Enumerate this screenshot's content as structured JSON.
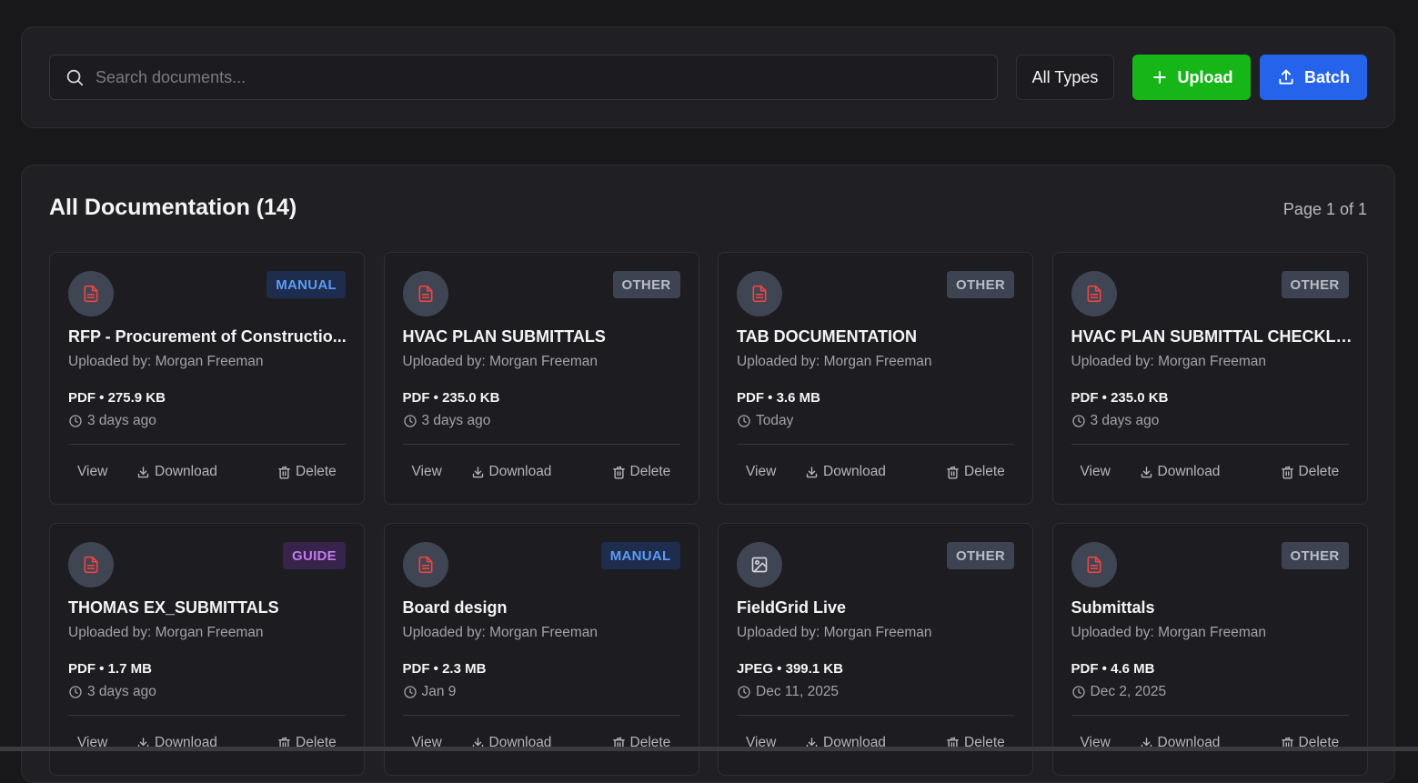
{
  "search": {
    "placeholder": "Search documents..."
  },
  "filters": {
    "type_selected": "All Types"
  },
  "actions": {
    "upload_label": "Upload",
    "batch_label": "Batch"
  },
  "documents": {
    "title": "All Documentation (14)",
    "page_info": "Page 1 of 1",
    "cards": [
      {
        "badge": "MANUAL",
        "badge_kind": "manual",
        "icon": "file-text-icon",
        "title": "RFP - Procurement of Constructio...",
        "uploader": "Uploaded by: Morgan Freeman",
        "meta": "PDF • 275.9 KB",
        "date": "3 days ago",
        "view": "View",
        "download": "Download",
        "delete": "Delete"
      },
      {
        "badge": "OTHER",
        "badge_kind": "other",
        "icon": "file-text-icon",
        "title": "HVAC PLAN SUBMITTALS",
        "uploader": "Uploaded by: Morgan Freeman",
        "meta": "PDF • 235.0 KB",
        "date": "3 days ago",
        "view": "View",
        "download": "Download",
        "delete": "Delete"
      },
      {
        "badge": "OTHER",
        "badge_kind": "other",
        "icon": "file-text-icon",
        "title": "TAB DOCUMENTATION",
        "uploader": "Uploaded by: Morgan Freeman",
        "meta": "PDF • 3.6 MB",
        "date": "Today",
        "view": "View",
        "download": "Download",
        "delete": "Delete"
      },
      {
        "badge": "OTHER",
        "badge_kind": "other",
        "icon": "file-text-icon",
        "title": "HVAC PLAN SUBMITTAL CHECKLI...",
        "uploader": "Uploaded by: Morgan Freeman",
        "meta": "PDF • 235.0 KB",
        "date": "3 days ago",
        "view": "View",
        "download": "Download",
        "delete": "Delete"
      },
      {
        "badge": "GUIDE",
        "badge_kind": "guide",
        "icon": "file-text-icon",
        "title": "THOMAS EX_SUBMITTALS",
        "uploader": "Uploaded by: Morgan Freeman",
        "meta": "PDF • 1.7 MB",
        "date": "3 days ago",
        "view": "View",
        "download": "Download",
        "delete": "Delete"
      },
      {
        "badge": "MANUAL",
        "badge_kind": "manual",
        "icon": "file-text-icon",
        "title": "Board design",
        "uploader": "Uploaded by: Morgan Freeman",
        "meta": "PDF • 2.3 MB",
        "date": "Jan 9",
        "view": "View",
        "download": "Download",
        "delete": "Delete"
      },
      {
        "badge": "OTHER",
        "badge_kind": "other",
        "icon": "image-icon",
        "title": "FieldGrid Live",
        "uploader": "Uploaded by: Morgan Freeman",
        "meta": "JPEG • 399.1 KB",
        "date": "Dec 11, 2025",
        "view": "View",
        "download": "Download",
        "delete": "Delete"
      },
      {
        "badge": "OTHER",
        "badge_kind": "other",
        "icon": "file-text-icon",
        "title": "Submittals",
        "uploader": "Uploaded by: Morgan Freeman",
        "meta": "PDF • 4.6 MB",
        "date": "Dec 2, 2025",
        "view": "View",
        "download": "Download",
        "delete": "Delete"
      }
    ]
  },
  "colors": {
    "background": "#18181b",
    "panel": "#202024",
    "upload_button": "#16b619",
    "batch_button": "#2563eb",
    "file_icon_red": "#ef4444"
  }
}
